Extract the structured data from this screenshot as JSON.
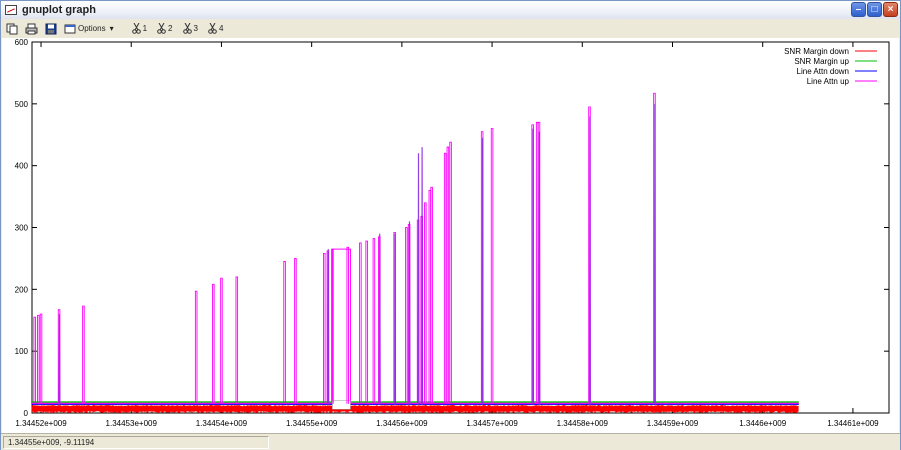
{
  "window": {
    "title": "gnuplot graph"
  },
  "toolbar": {
    "options_label": "Options",
    "options_arrow": "▾",
    "mark_buttons": [
      "1",
      "2",
      "3",
      "4"
    ]
  },
  "status": {
    "coords": "1.34455e+009, -9.11194"
  },
  "colors": {
    "snr_down": "#ff0000",
    "snr_up": "#00c000",
    "attn_down": "#0000ff",
    "attn_up": "#ff00ff",
    "title_gradient_end": "#dde3ef"
  },
  "chart_data": {
    "type": "line",
    "title": "",
    "xlabel": "",
    "ylabel": "",
    "xlim": [
      1344519000,
      1344614000
    ],
    "ylim": [
      0,
      600
    ],
    "x_ticks": [
      "1.34452e+009",
      "1.34453e+009",
      "1.34454e+009",
      "1.34455e+009",
      "1.34456e+009",
      "1.34457e+009",
      "1.34458e+009",
      "1.34459e+009",
      "1.3446e+009",
      "1.34461e+009"
    ],
    "x_tick_values": [
      1344520000,
      1344530000,
      1344540000,
      1344550000,
      1344560000,
      1344570000,
      1344580000,
      1344590000,
      1344600000,
      1344610000
    ],
    "y_ticks": [
      0,
      100,
      200,
      300,
      400,
      500,
      600
    ],
    "legend_position": "top-right",
    "series": [
      {
        "name": "SNR Margin down",
        "color_key": "snr_down",
        "baseline": 8,
        "band": [
          3,
          13
        ],
        "x_range": [
          1344519000,
          1344604000
        ]
      },
      {
        "name": "SNR Margin up",
        "color_key": "snr_up",
        "baseline": 18,
        "band": [
          16,
          19
        ],
        "x_range": [
          1344519000,
          1344604000
        ]
      },
      {
        "name": "Line Attn down",
        "color_key": "attn_down",
        "baseline": 14,
        "spikes": [
          {
            "x": 1344522000,
            "y": 160
          },
          {
            "x": 1344551800,
            "y": 265
          },
          {
            "x": 1344557500,
            "y": 290
          },
          {
            "x": 1344559200,
            "y": 290
          },
          {
            "x": 1344560800,
            "y": 310
          },
          {
            "x": 1344561800,
            "y": 420
          },
          {
            "x": 1344562200,
            "y": 430
          },
          {
            "x": 1344568900,
            "y": 445
          },
          {
            "x": 1344574500,
            "y": 460
          },
          {
            "x": 1344575200,
            "y": 455
          },
          {
            "x": 1344580800,
            "y": 480
          },
          {
            "x": 1344588000,
            "y": 500
          }
        ]
      },
      {
        "name": "Line Attn up",
        "color_key": "attn_up",
        "baseline": 15,
        "spikes": [
          {
            "x": 1344519300,
            "y": 155
          },
          {
            "x": 1344519700,
            "y": 158
          },
          {
            "x": 1344520000,
            "y": 160
          },
          {
            "x": 1344522000,
            "y": 167
          },
          {
            "x": 1344524700,
            "y": 173
          },
          {
            "x": 1344537200,
            "y": 197
          },
          {
            "x": 1344539100,
            "y": 208
          },
          {
            "x": 1344540000,
            "y": 218
          },
          {
            "x": 1344541700,
            "y": 220
          },
          {
            "x": 1344547000,
            "y": 245
          },
          {
            "x": 1344548200,
            "y": 250
          },
          {
            "x": 1344551400,
            "y": 258
          },
          {
            "x": 1344551800,
            "y": 262
          },
          {
            "x": 1344552300,
            "y": 265
          },
          {
            "x": 1344554000,
            "y": 268
          },
          {
            "x": 1344555400,
            "y": 275
          },
          {
            "x": 1344556100,
            "y": 278
          },
          {
            "x": 1344556900,
            "y": 282
          },
          {
            "x": 1344557500,
            "y": 285
          },
          {
            "x": 1344559200,
            "y": 292
          },
          {
            "x": 1344560500,
            "y": 300
          },
          {
            "x": 1344560800,
            "y": 305
          },
          {
            "x": 1344561800,
            "y": 312
          },
          {
            "x": 1344562200,
            "y": 318
          },
          {
            "x": 1344562600,
            "y": 340
          },
          {
            "x": 1344563100,
            "y": 360
          },
          {
            "x": 1344563300,
            "y": 365
          },
          {
            "x": 1344564800,
            "y": 420
          },
          {
            "x": 1344565100,
            "y": 430
          },
          {
            "x": 1344565400,
            "y": 438
          },
          {
            "x": 1344568900,
            "y": 455
          },
          {
            "x": 1344570000,
            "y": 460
          },
          {
            "x": 1344574500,
            "y": 466
          },
          {
            "x": 1344575000,
            "y": 470
          },
          {
            "x": 1344575200,
            "y": 470
          },
          {
            "x": 1344580800,
            "y": 495
          },
          {
            "x": 1344588000,
            "y": 517
          }
        ],
        "plateau": {
          "x_start": 1344552300,
          "x_end": 1344554300,
          "y": 265
        }
      }
    ]
  }
}
